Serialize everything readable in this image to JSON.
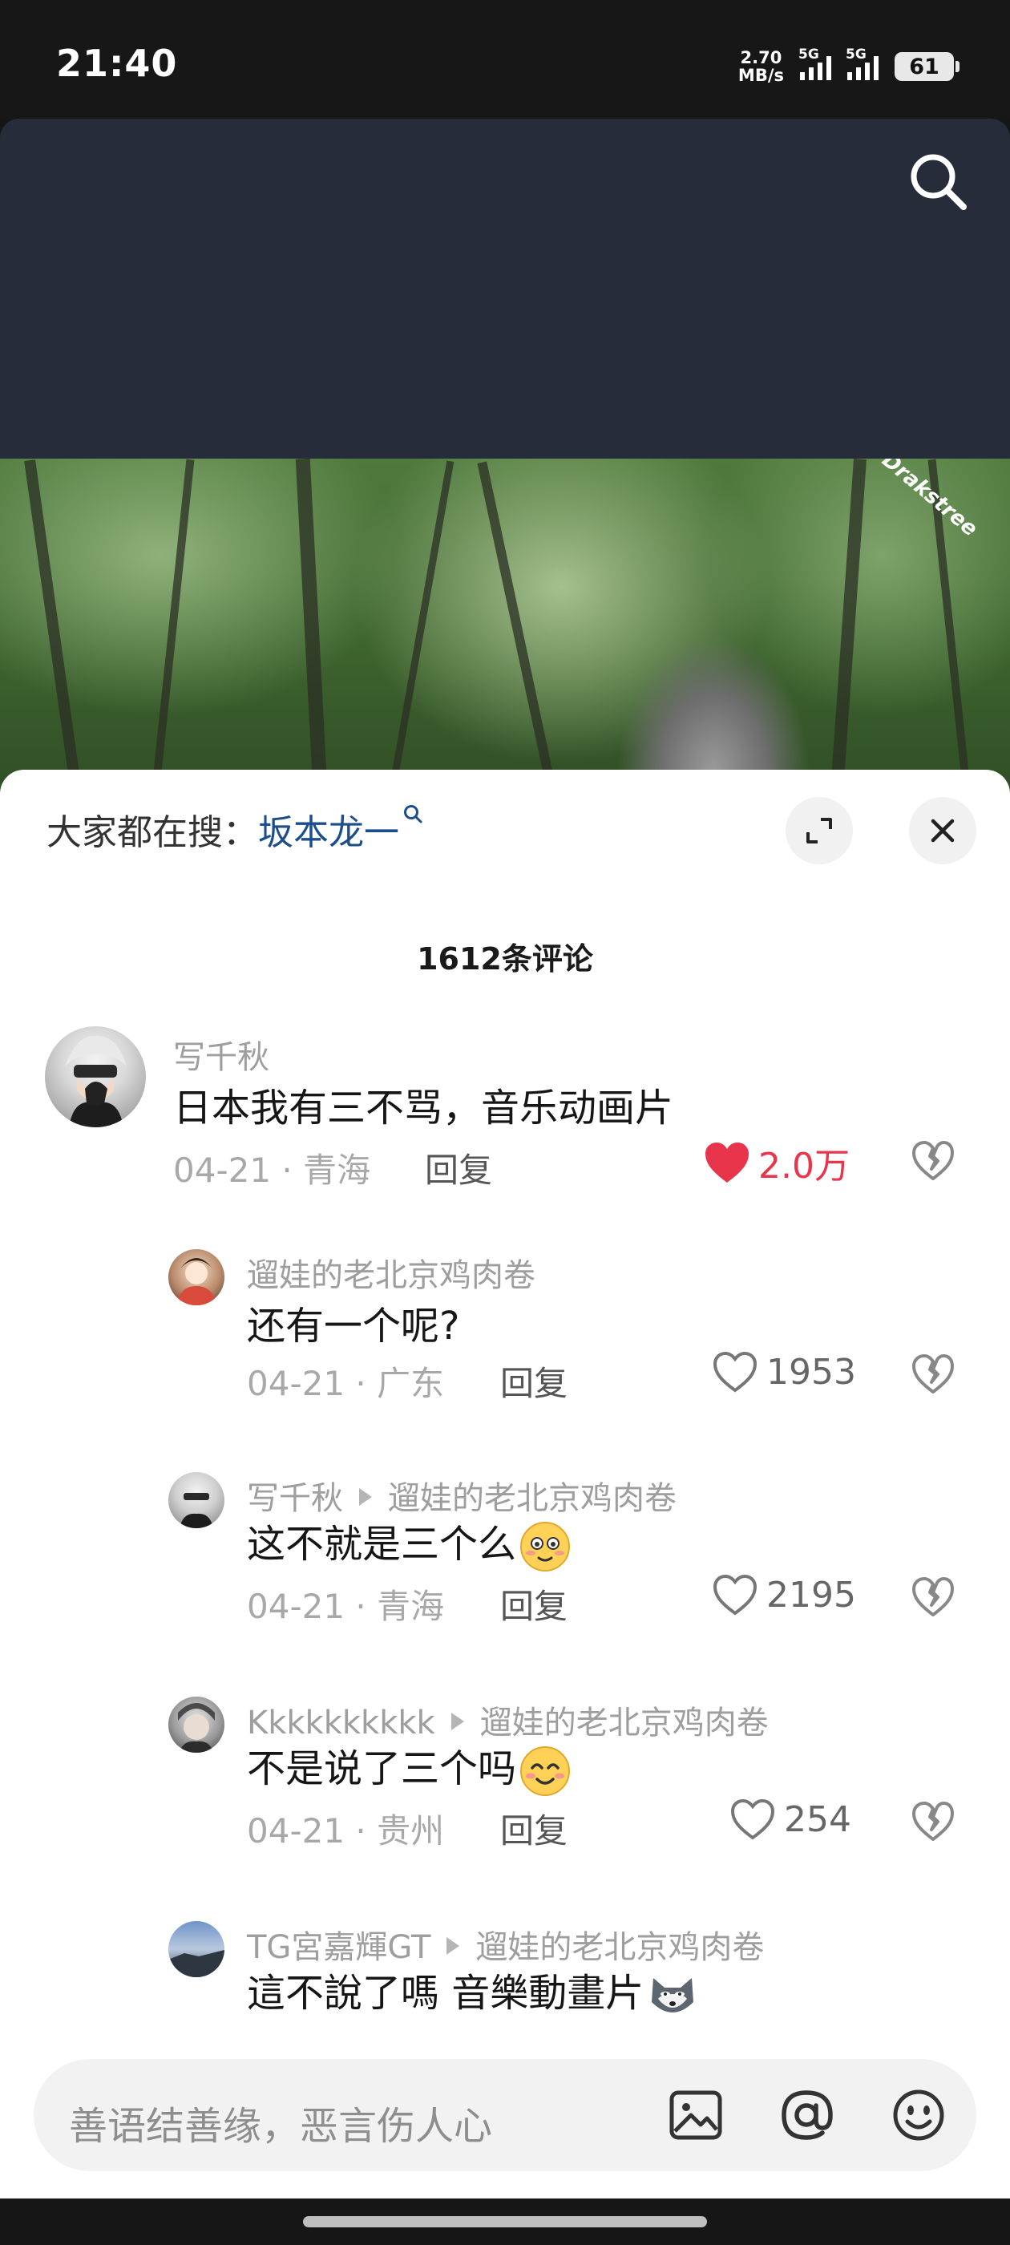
{
  "status_bar": {
    "time": "21:40",
    "speed_value": "2.70",
    "speed_unit": "MB/s",
    "signal1_label": "5G",
    "signal2_label": "5G",
    "battery": "61"
  },
  "header": {
    "search_icon": "search-icon"
  },
  "video": {
    "watermark": "Drakstree"
  },
  "sheet": {
    "hot_search_prefix": "大家都在搜：",
    "hot_search_keyword": "坂本龙一",
    "comment_count": "1612条评论",
    "comments": [
      {
        "username": "写千秋",
        "text": "日本我有三不骂，音乐动画片",
        "date": "04-21 · 青海",
        "reply_label": "回复",
        "likes": "2.0万",
        "liked": true
      },
      {
        "username": "遛娃的老北京鸡肉卷",
        "text": "还有一个呢?",
        "date": "04-21 · 广东",
        "reply_label": "回复",
        "likes": "1953",
        "liked": false
      },
      {
        "username": "写千秋",
        "reply_to": "遛娃的老北京鸡肉卷",
        "text": "这不就是三个么",
        "date": "04-21 · 青海",
        "reply_label": "回复",
        "likes": "2195",
        "liked": false
      },
      {
        "username": "Kkkkkkkkkk",
        "reply_to": "遛娃的老北京鸡肉卷",
        "text": "不是说了三个吗",
        "date": "04-21 · 贵州",
        "reply_label": "回复",
        "likes": "254",
        "liked": false
      },
      {
        "username": "TG宮嘉輝GT",
        "reply_to": "遛娃的老北京鸡肉卷",
        "text": "這不說了嗎 音樂動畫片"
      }
    ]
  },
  "input_bar": {
    "placeholder": "善语结善缘，恶言伤人心"
  },
  "colors": {
    "like_red": "#e8354b",
    "link_blue": "#1c4d8c",
    "header_bg": "#272c3b"
  }
}
